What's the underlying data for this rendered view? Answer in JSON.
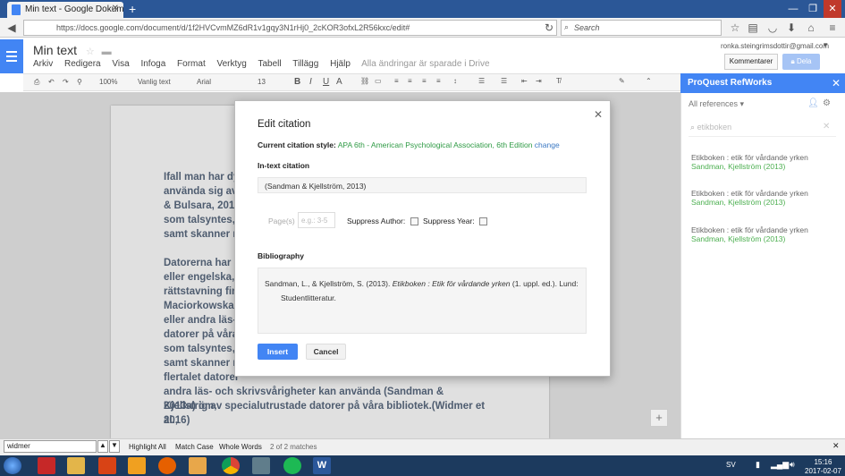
{
  "browser": {
    "tab_title": "Min text - Google Dokument",
    "url": "https://docs.google.com/document/d/1f2HVCvmMZ6dR1v1gqy3N1rHj0_2cKOR3ofxL2R56kxc/edit#",
    "search_placeholder": "Search"
  },
  "doc": {
    "title": "Min text",
    "menus": [
      "Arkiv",
      "Redigera",
      "Visa",
      "Infoga",
      "Format",
      "Verktyg",
      "Tabell",
      "Tillägg",
      "Hjälp"
    ],
    "save_status": "Alla ändringar är sparade i Drive",
    "user_email": "ronka.steingrimsdottir@gmail.com",
    "comments_label": "Kommentarer",
    "share_label": "Dela",
    "toolbar": {
      "zoom": "100%",
      "style": "Vanlig text",
      "font": "Arial",
      "size": "13"
    },
    "body_lines": [
      "Ifall man har dy",
      "använda sig av",
      "& Bulsara, 2016",
      "som talsyntes, l",
      "samt skanner m",
      "",
      "Datorerna har p",
      "eller engelska, l",
      "rättstavning fin",
      "Maciorkowska,",
      "eller andra läs-",
      "datorer på våra",
      "som talsyntes,",
      "samt skanner m",
      "flertalet datorer",
      "andra läs- och skrivsvårigheter kan använda (Sandman & Kjellström,",
      "2013a) ig av specialutrustade datorer på våra bibliotek.(Widmer et al.,",
      "2016)"
    ]
  },
  "dialog": {
    "title": "Edit citation",
    "citation_style_label": "Current citation style:",
    "citation_style_value": "APA 6th - American Psychological Association, 6th Edition",
    "change_label": "change",
    "intext_label": "In-text citation",
    "intext_value": "(Sandman & Kjellström, 2013)",
    "pages_label": "Page(s)",
    "pages_placeholder": "e.g.: 3-5",
    "suppress_author_label": "Suppress Author:",
    "suppress_year_label": "Suppress Year:",
    "bibliography_label": "Bibliography",
    "bib_part1": "Sandman, L., & Kjellström, S. (2013). ",
    "bib_title": "Etikboken : Etik för vårdande yrken",
    "bib_part2": " (1. uppl. ed.). Lund:",
    "bib_line2": "Studentlitteratur.",
    "insert_label": "Insert",
    "cancel_label": "Cancel"
  },
  "sidebar": {
    "title": "ProQuest RefWorks",
    "all_refs_label": "All references",
    "search_placeholder": "etikboken",
    "refs": [
      {
        "title": "Etikboken : etik för vårdande yrken",
        "authors": "Sandman, Kjellström (2013)"
      },
      {
        "title": "Etikboken : etik för vårdande yrken",
        "authors": "Sandman, Kjellström (2013)"
      },
      {
        "title": "Etikboken : etik för vårdande yrken",
        "authors": "Sandman, Kjellström (2013)"
      }
    ]
  },
  "findbar": {
    "query": "widmer",
    "highlight_label": "Highlight All",
    "matchcase_label": "Match Case",
    "wholewords_label": "Whole Words",
    "matches_label": "2 of 2 matches"
  },
  "taskbar": {
    "lang": "SV",
    "time": "15:16",
    "date": "2017-02-07"
  }
}
